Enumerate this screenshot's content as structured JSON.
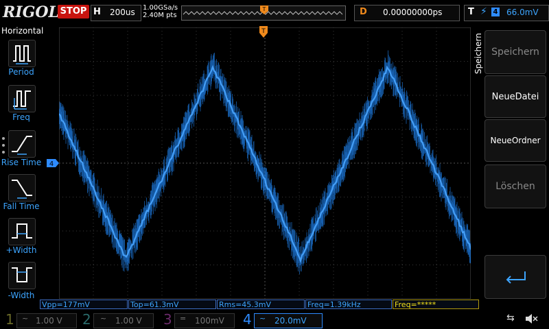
{
  "header": {
    "logo": "RIGOL",
    "run_state": "STOP",
    "timebase_label": "H",
    "timebase_value": "200us",
    "sample_rate": "1.00GSa/s",
    "memory_depth": "2.40M pts",
    "delay_label": "D",
    "delay_value": "0.00000000ps",
    "trigger_label": "T",
    "trigger_source": "4",
    "trigger_level": "66.0mV"
  },
  "left_panel": {
    "title": "Horizontal",
    "items": [
      {
        "label": "Period",
        "icon": "period-icon"
      },
      {
        "label": "Freq",
        "icon": "frequency-icon"
      },
      {
        "label": "Rise Time",
        "icon": "rise-time-icon"
      },
      {
        "label": "Fall Time",
        "icon": "fall-time-icon"
      },
      {
        "label": "+Width",
        "icon": "positive-width-icon"
      },
      {
        "label": "-Width",
        "icon": "negative-width-icon"
      }
    ]
  },
  "right_panel": {
    "title": "Speichern",
    "buttons": [
      {
        "label": "Speichern",
        "enabled": false
      },
      {
        "label": "NeueDatei",
        "enabled": true
      },
      {
        "label": "NeueOrdner",
        "enabled": true
      },
      {
        "label": "Löschen",
        "enabled": false
      }
    ],
    "enter_icon": "enter-return-icon"
  },
  "measurements": [
    {
      "text": "Vpp=177mV",
      "color": "#3da5ff"
    },
    {
      "text": "Top=61.3mV",
      "color": "#3da5ff"
    },
    {
      "text": "Rms=45.3mV",
      "color": "#3da5ff"
    },
    {
      "text": "Freq=1.39kHz",
      "color": "#3da5ff"
    },
    {
      "text": "Freq=*****",
      "color": "#f5e21a"
    }
  ],
  "channels": [
    {
      "number": "1",
      "coupling": "~",
      "scale": "1.00 V",
      "color": "#9a9a30",
      "active": false
    },
    {
      "number": "2",
      "coupling": "~",
      "scale": "1.00 V",
      "color": "#2f8a8a",
      "active": false
    },
    {
      "number": "3",
      "coupling": "=",
      "scale": "100mV",
      "color": "#8a2f8a",
      "active": false
    },
    {
      "number": "4",
      "coupling": "~",
      "scale": "20.0mV",
      "color": "#2e8bff",
      "active": true
    }
  ],
  "status_icons": [
    "usb-icon",
    "speaker-mute-icon"
  ],
  "waveform": {
    "channel": "4",
    "ch4_marker": "4",
    "trigger_marker": "T",
    "color": "#1f7fe8"
  }
}
